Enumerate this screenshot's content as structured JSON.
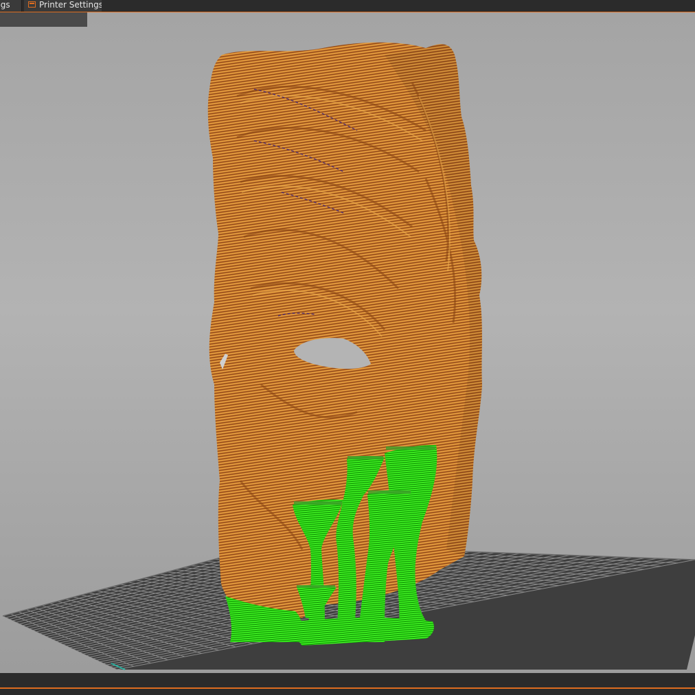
{
  "tabs": [
    {
      "label": "Print Settings"
    },
    {
      "label": "Printer Settings"
    }
  ],
  "colors": {
    "accent": "#e06d1f",
    "model": "#c8702d",
    "support": "#22dd0b",
    "bed": "#3e3e3e",
    "grid_lines": "#8a8a8a",
    "background": "#b0b0b0"
  },
  "viewport": {
    "objects": [
      {
        "name": "mask-model"
      },
      {
        "name": "tree-supports"
      },
      {
        "name": "print-bed-grid"
      }
    ]
  }
}
